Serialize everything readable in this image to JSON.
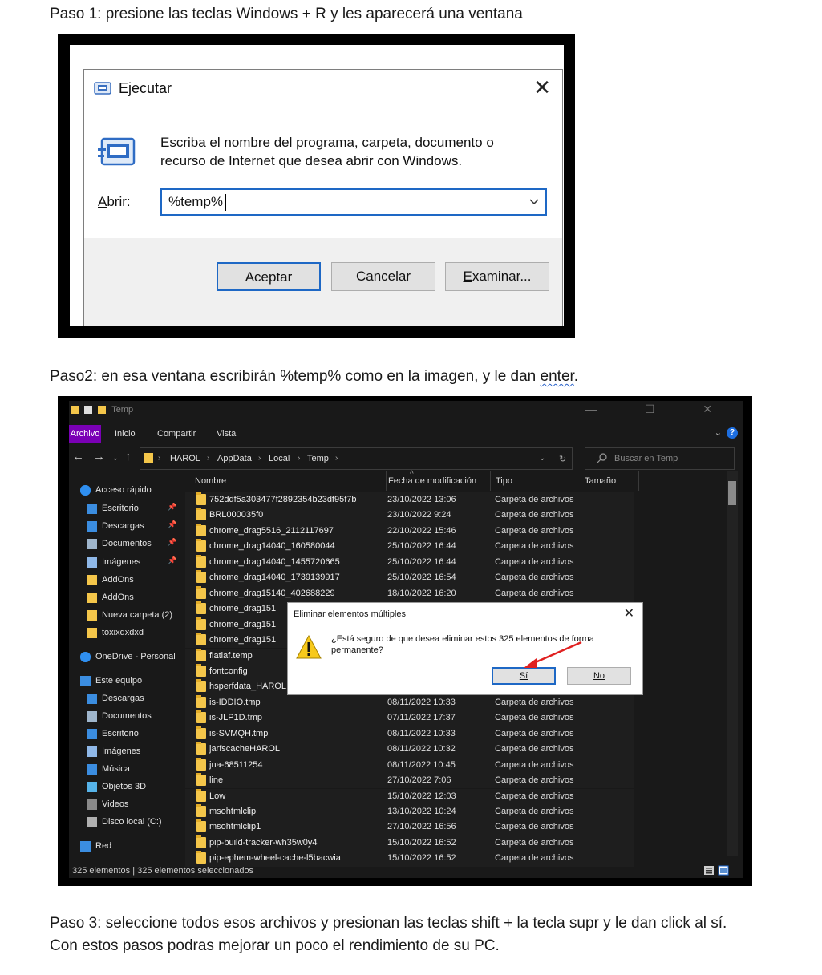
{
  "steps": {
    "step1": "Paso 1: presione las teclas Windows + R y les aparecerá una ventana",
    "step2_before": "Paso2: en esa ventana escribirán %temp% como en la imagen, y le dan ",
    "step2_enter": "enter",
    "step2_after": ".",
    "step3": "Paso 3: seleccione todos esos archivos y presionan las teclas shift + la tecla supr y le dan click al sí. Con estos pasos podras  mejorar un poco el rendimiento de su PC."
  },
  "run_dialog": {
    "title": "Ejecutar",
    "close": "✕",
    "description": "Escriba el nombre del programa, carpeta, documento o recurso de Internet que desea abrir con Windows.",
    "open_label": "Abrir:",
    "open_value": "%temp%",
    "ok": "Aceptar",
    "cancel": "Cancelar",
    "browse": "Examinar..."
  },
  "explorer": {
    "window_title": "Temp",
    "window_controls": "— ☐ ✕",
    "ribbon_tabs": [
      "Archivo",
      "Inicio",
      "Compartir",
      "Vista"
    ],
    "breadcrumb": [
      "HAROL",
      "AppData",
      "Local",
      "Temp"
    ],
    "search_placeholder": "Buscar en Temp",
    "columns": [
      "Nombre",
      "Fecha de modificación",
      "Tipo",
      "Tamaño"
    ],
    "sidebar": [
      {
        "label": "Acceso rápido",
        "icon": "star-icon",
        "pinned": false
      },
      {
        "label": "Escritorio",
        "icon": "desktop-icon",
        "pinned": true
      },
      {
        "label": "Descargas",
        "icon": "download-icon",
        "pinned": true
      },
      {
        "label": "Documentos",
        "icon": "documents-icon",
        "pinned": true
      },
      {
        "label": "Imágenes",
        "icon": "images-icon",
        "pinned": true
      },
      {
        "label": "AddOns",
        "icon": "folder-icon",
        "pinned": false
      },
      {
        "label": "AddOns",
        "icon": "folder-icon",
        "pinned": false
      },
      {
        "label": "Nueva carpeta (2)",
        "icon": "folder-icon",
        "pinned": false
      },
      {
        "label": "toxixdxdxd",
        "icon": "folder-icon",
        "pinned": false
      },
      {
        "label": "OneDrive - Personal",
        "icon": "cloud-icon",
        "pinned": false
      },
      {
        "label": "Este equipo",
        "icon": "computer-icon",
        "pinned": false
      },
      {
        "label": "Descargas",
        "icon": "download-icon",
        "pinned": false
      },
      {
        "label": "Documentos",
        "icon": "documents-icon",
        "pinned": false
      },
      {
        "label": "Escritorio",
        "icon": "desktop-icon",
        "pinned": false
      },
      {
        "label": "Imágenes",
        "icon": "images-icon",
        "pinned": false
      },
      {
        "label": "Música",
        "icon": "music-icon",
        "pinned": false
      },
      {
        "label": "Objetos 3D",
        "icon": "cube-icon",
        "pinned": false
      },
      {
        "label": "Videos",
        "icon": "video-icon",
        "pinned": false
      },
      {
        "label": "Disco local (C:)",
        "icon": "drive-icon",
        "pinned": false
      },
      {
        "label": "Red",
        "icon": "network-icon",
        "pinned": false
      }
    ],
    "files": [
      {
        "name": "752ddf5a303477f2892354b23df95f7b",
        "date": "23/10/2022 13:06",
        "type": "Carpeta de archivos"
      },
      {
        "name": "BRL000035f0",
        "date": "23/10/2022 9:24",
        "type": "Carpeta de archivos"
      },
      {
        "name": "chrome_drag5516_2112117697",
        "date": "22/10/2022 15:46",
        "type": "Carpeta de archivos"
      },
      {
        "name": "chrome_drag14040_160580044",
        "date": "25/10/2022 16:44",
        "type": "Carpeta de archivos"
      },
      {
        "name": "chrome_drag14040_1455720665",
        "date": "25/10/2022 16:44",
        "type": "Carpeta de archivos"
      },
      {
        "name": "chrome_drag14040_1739139917",
        "date": "25/10/2022 16:54",
        "type": "Carpeta de archivos"
      },
      {
        "name": "chrome_drag15140_402688229",
        "date": "18/10/2022 16:20",
        "type": "Carpeta de archivos"
      },
      {
        "name": "chrome_drag151",
        "date": "",
        "type": ""
      },
      {
        "name": "chrome_drag151",
        "date": "",
        "type": ""
      },
      {
        "name": "chrome_drag151",
        "date": "",
        "type": ""
      },
      {
        "name": "flatlaf.temp",
        "date": "",
        "type": ""
      },
      {
        "name": "fontconfig",
        "date": "",
        "type": ""
      },
      {
        "name": "hsperfdata_HAROL",
        "date": "",
        "type": ""
      },
      {
        "name": "is-IDDIO.tmp",
        "date": "08/11/2022 10:33",
        "type": "Carpeta de archivos"
      },
      {
        "name": "is-JLP1D.tmp",
        "date": "07/11/2022 17:37",
        "type": "Carpeta de archivos"
      },
      {
        "name": "is-SVMQH.tmp",
        "date": "08/11/2022 10:33",
        "type": "Carpeta de archivos"
      },
      {
        "name": "jarfscacheHAROL",
        "date": "08/11/2022 10:32",
        "type": "Carpeta de archivos"
      },
      {
        "name": "jna-68511254",
        "date": "08/11/2022 10:45",
        "type": "Carpeta de archivos"
      },
      {
        "name": "line",
        "date": "27/10/2022 7:06",
        "type": "Carpeta de archivos"
      },
      {
        "name": "Low",
        "date": "15/10/2022 12:03",
        "type": "Carpeta de archivos"
      },
      {
        "name": "msohtmlclip",
        "date": "13/10/2022 10:24",
        "type": "Carpeta de archivos"
      },
      {
        "name": "msohtmlclip1",
        "date": "27/10/2022 16:56",
        "type": "Carpeta de archivos"
      },
      {
        "name": "pip-build-tracker-wh35w0y4",
        "date": "15/10/2022 16:52",
        "type": "Carpeta de archivos"
      },
      {
        "name": "pip-ephem-wheel-cache-l5bacwia",
        "date": "15/10/2022 16:52",
        "type": "Carpeta de archivos"
      }
    ],
    "status": "325 elementos   |   325 elementos seleccionados   |"
  },
  "delete_dialog": {
    "title": "Eliminar elementos múltiples",
    "close": "✕",
    "message": "¿Está seguro de que desea eliminar estos 325 elementos de forma permanente?",
    "yes": "Sí",
    "no": "No"
  },
  "colors": {
    "accent": "#1e68c5",
    "archivo_tab": "#7a00b5",
    "folder": "#f4c64a",
    "arrow": "#e02020"
  }
}
